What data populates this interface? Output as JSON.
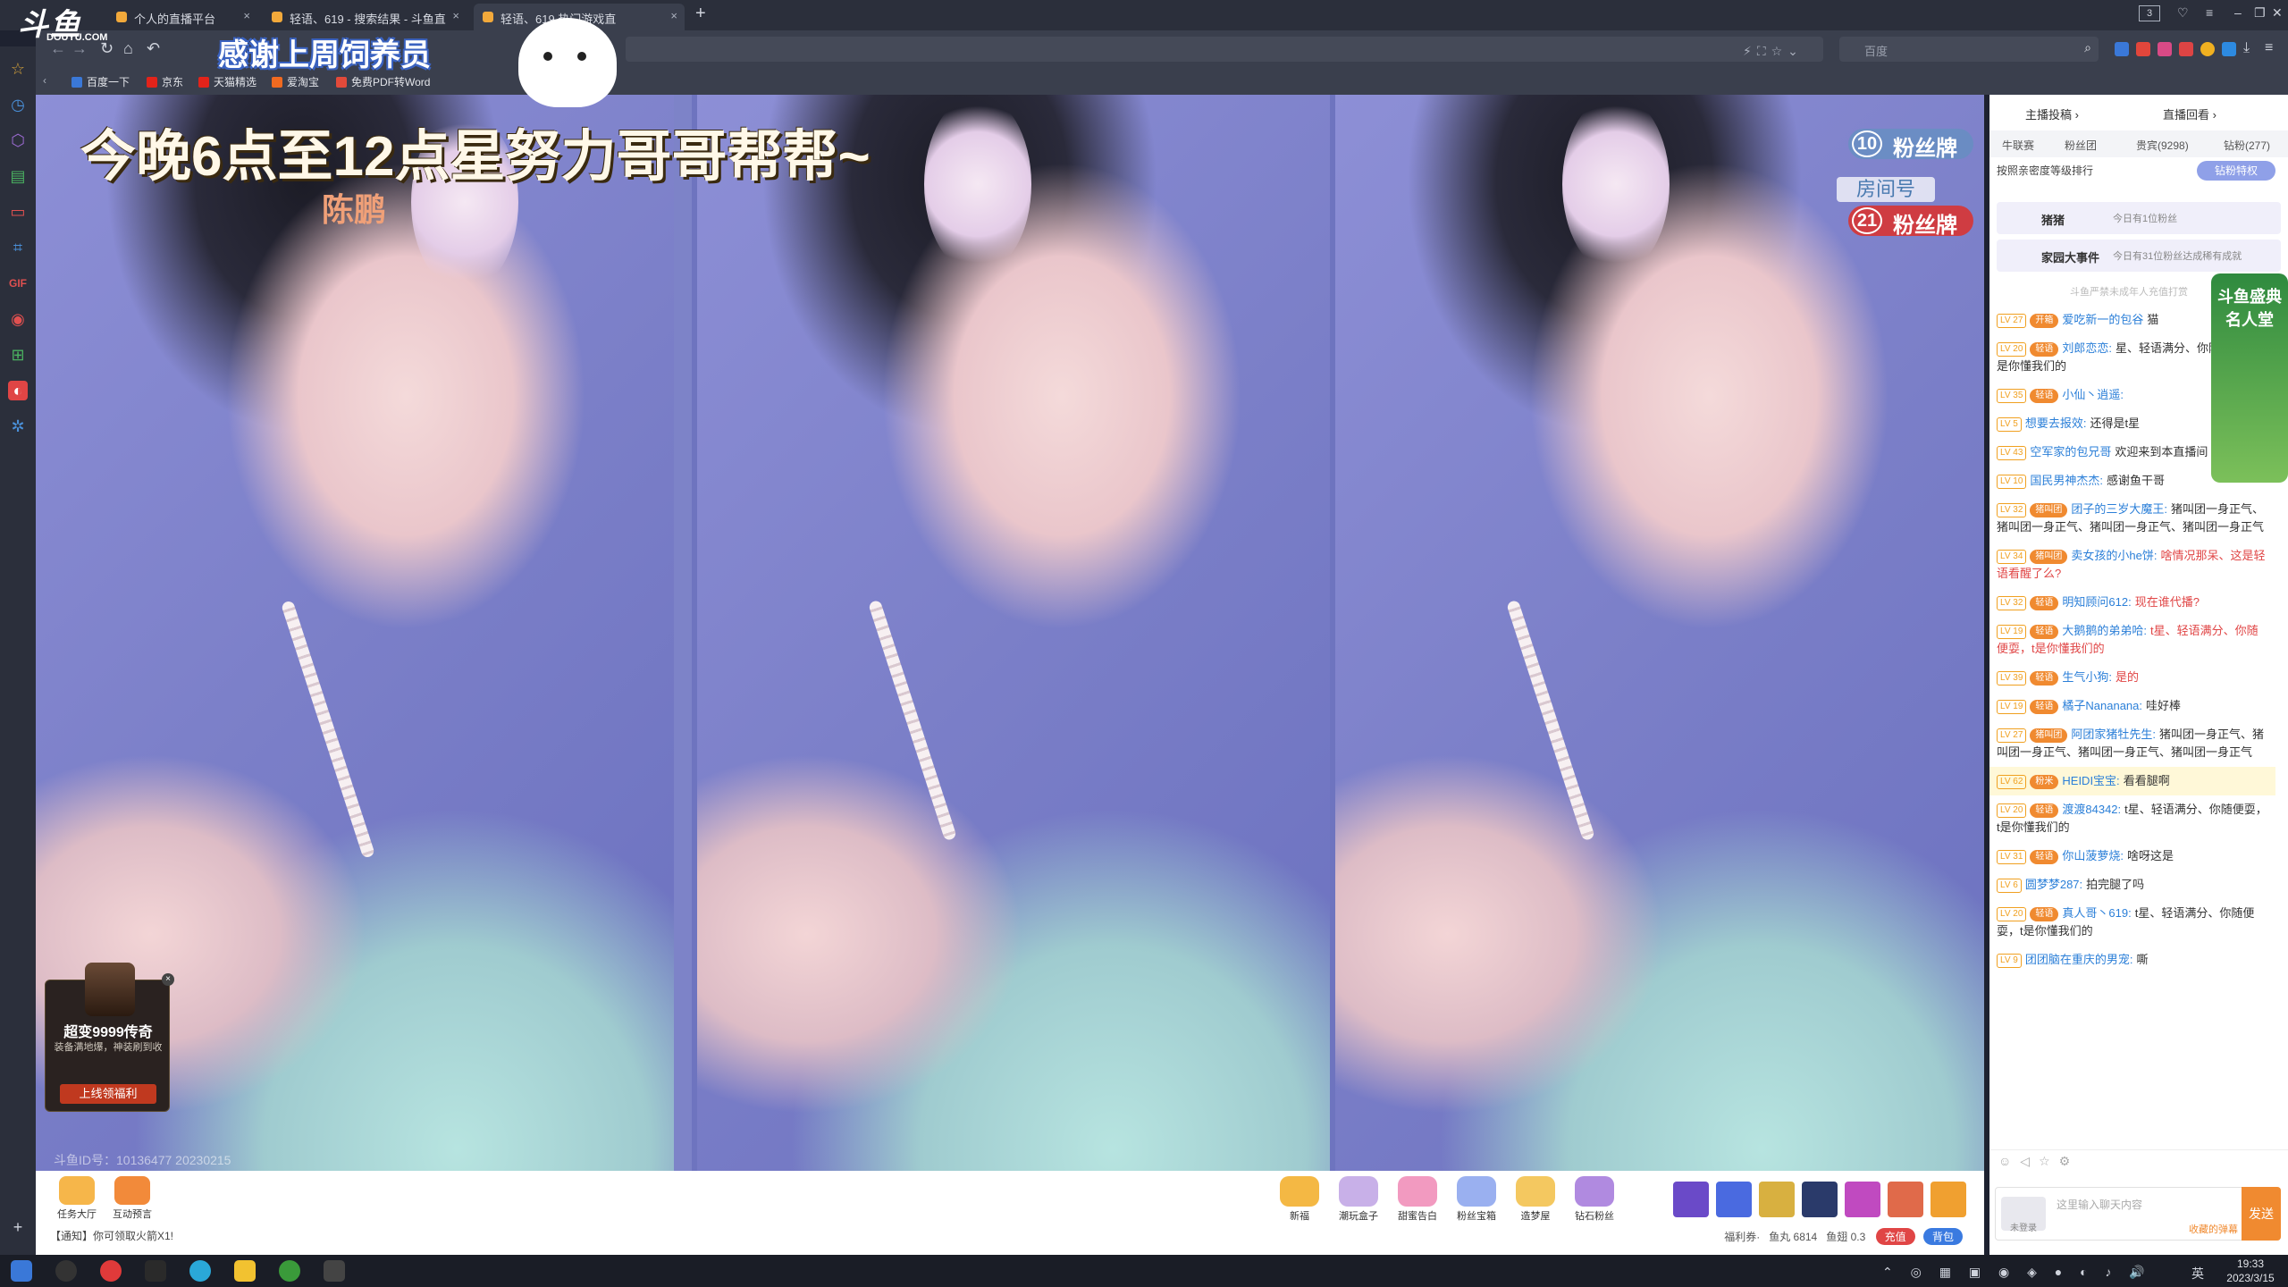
{
  "browser": {
    "tabs": [
      {
        "title": "个人的直播平台",
        "active": false
      },
      {
        "title": "轻语、619 - 搜索结果 - 斗鱼直",
        "active": false
      },
      {
        "title": "轻语、619 热门游戏直",
        "active": true
      }
    ],
    "tab_count": "3",
    "search_placeholder": "百度",
    "bookmarks": [
      "百度一下",
      "京东",
      "天猫精选",
      "爱淘宝",
      "免费PDF转Word"
    ]
  },
  "logo": {
    "text": "斗鱼",
    "subtext": "DOUYU.COM"
  },
  "overlay": {
    "thanks_banner": "感谢上周饲养员",
    "name_tag": "陈鹏",
    "caption": "今晚6点至12点星努力哥哥帮帮~",
    "fan_badge_1": {
      "level": "10",
      "label": "粉丝牌"
    },
    "fan_badge_2": {
      "level": "21",
      "label": "粉丝牌"
    },
    "room_label": "房间号",
    "watermark": "斗鱼ID号：10136477 20230215"
  },
  "ad": {
    "title": "超变9999传奇",
    "subtitle": "装备满地爆，神装刷到收",
    "button": "上线领福利",
    "close": "×"
  },
  "chat": {
    "header_left": "主播投稿 ›",
    "header_right": "直播回看 ›",
    "tabs": [
      "牛联赛",
      "粉丝团",
      "贵宾(9298)",
      "钻粉(277)"
    ],
    "rank_label": "按照亲密度等级排行",
    "vip_button": "钻粉特权",
    "featured_1": {
      "name": "猪猪",
      "note": "今日有1位粉丝"
    },
    "featured_2": {
      "name": "家园大事件",
      "note": "今日有31位粉丝达成稀有成就"
    },
    "tip": "斗鱼严禁未成年人充值打赏",
    "messages": [
      {
        "lvl": "LV 27",
        "medal": "开箱",
        "user": "爱吃新一的包谷",
        "text": "猫",
        "red": false,
        "hl": false
      },
      {
        "lvl": "LV 20",
        "medal": "轻语",
        "user": "刘郎恋恋:",
        "text": "星、轻语满分、你随便耍，t是你懂我们的",
        "red": false,
        "hl": false
      },
      {
        "lvl": "LV 35",
        "medal": "轻语",
        "user": "小仙丶逍遥:",
        "text": "",
        "red": false,
        "hl": false
      },
      {
        "lvl": "LV 5",
        "medal": "",
        "user": "想要去报效:",
        "text": "还得是t星",
        "red": false,
        "hl": false
      },
      {
        "lvl": "LV 43",
        "medal": "",
        "user": "空军家的包兄哥",
        "text": "欢迎来到本直播间",
        "red": false,
        "hl": false
      },
      {
        "lvl": "LV 10",
        "medal": "",
        "user": "国民男神杰杰:",
        "text": "感谢鱼干哥",
        "red": false,
        "hl": false
      },
      {
        "lvl": "LV 32",
        "medal": "猪叫团",
        "user": "团子的三岁大魔王:",
        "text": "猪叫团一身正气、猪叫团一身正气、猪叫团一身正气、猪叫团一身正气",
        "red": false,
        "hl": false
      },
      {
        "lvl": "LV 34",
        "medal": "猪叫团",
        "user": "卖女孩的小he饼:",
        "text": "啥情况那呆、这是轻语看醒了么?",
        "red": true,
        "hl": false
      },
      {
        "lvl": "LV 32",
        "medal": "轻语",
        "user": "明知顾问612:",
        "text": "现在谁代播?",
        "red": true,
        "hl": false
      },
      {
        "lvl": "LV 19",
        "medal": "轻语",
        "user": "大鹅鹅的弟弟哈:",
        "text": "t星、轻语满分、你随便耍，t是你懂我们的",
        "red": true,
        "hl": false
      },
      {
        "lvl": "LV 39",
        "medal": "轻语",
        "user": "生气小狗:",
        "text": "是的",
        "red": true,
        "hl": false
      },
      {
        "lvl": "LV 19",
        "medal": "轻语",
        "user": "橘子Nananana:",
        "text": "哇好棒",
        "red": false,
        "hl": false
      },
      {
        "lvl": "LV 27",
        "medal": "猪叫团",
        "user": "阿团家猪牡先生:",
        "text": "猪叫团一身正气、猪叫团一身正气、猪叫团一身正气、猪叫团一身正气",
        "red": false,
        "hl": false
      },
      {
        "lvl": "LV 62",
        "medal": "粉米",
        "user": "HEIDI宝宝:",
        "text": "看看腿啊",
        "red": false,
        "hl": true
      },
      {
        "lvl": "LV 20",
        "medal": "轻语",
        "user": "渡渡84342:",
        "text": "t星、轻语满分、你随便耍，t是你懂我们的",
        "red": false,
        "hl": false
      },
      {
        "lvl": "LV 31",
        "medal": "轻语",
        "user": "你山菠萝烧:",
        "text": "啥呀这是",
        "red": false,
        "hl": false
      },
      {
        "lvl": "LV 6",
        "medal": "",
        "user": "圆梦梦287:",
        "text": "拍完腿了吗",
        "red": false,
        "hl": false
      },
      {
        "lvl": "LV 20",
        "medal": "轻语",
        "user": "真人哥丶619:",
        "text": "t星、轻语满分、你随便耍，t是你懂我们的",
        "red": false,
        "hl": false
      },
      {
        "lvl": "LV 9",
        "medal": "",
        "user": "团团脑在重庆的男宠:",
        "text": "嘶",
        "red": false,
        "hl": false
      }
    ],
    "float_banner": "斗鱼盛典名人堂",
    "input_placeholder": "这里输入聊天内容",
    "input_rank": "收藏的弹幕",
    "send": "发送",
    "avatar_label": "未登录"
  },
  "giftbar": {
    "left_buttons": [
      "任务大厅",
      "互动预言"
    ],
    "gifts": [
      "新福",
      "潮玩盒子",
      "甜蜜告白",
      "粉丝宝箱",
      "造梦屋",
      "钻石粉丝"
    ],
    "notice": "【通知】你可领取火箭X1!",
    "stats": {
      "welfare": "福利券·",
      "yuwan": "鱼丸 6814",
      "yuchi": "鱼翅 0.3",
      "recharge": "充值",
      "bag": "背包"
    }
  },
  "taskbar": {
    "time": "19:33",
    "date": "2023/3/15",
    "lang": "英"
  }
}
